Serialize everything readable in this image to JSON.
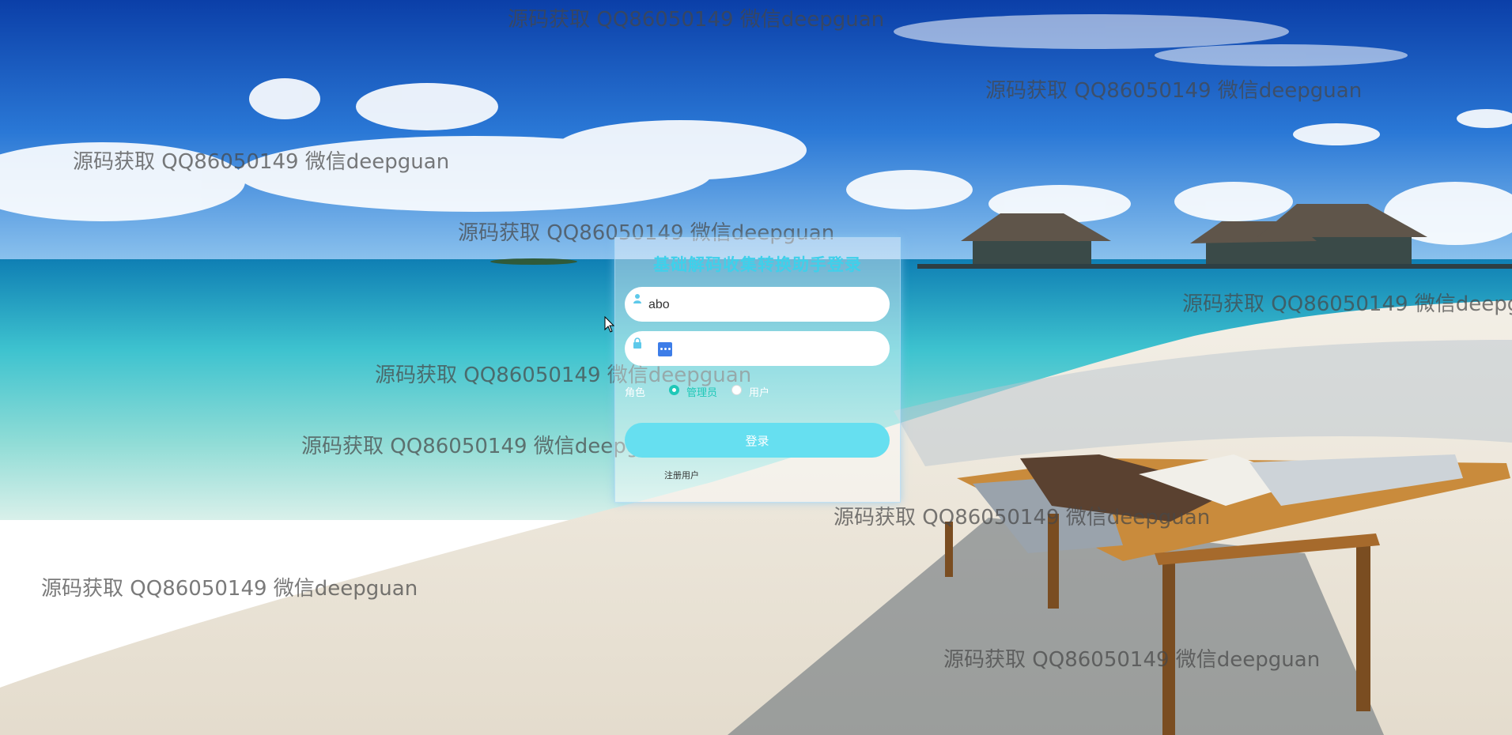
{
  "login": {
    "title": "基础解码收集转换助手登录",
    "username_value": "abo",
    "role_label": "角色",
    "roles": [
      {
        "label": "管理员",
        "selected": true
      },
      {
        "label": "用户",
        "selected": false
      }
    ],
    "login_button": "登录",
    "register_link": "注册用户"
  },
  "watermark": {
    "text": "源码获取 QQ86050149 微信deepguan"
  },
  "icons": {
    "username": "user-icon",
    "password": "lock-icon",
    "password_manager": "key-dots-icon",
    "cursor": "mouse-pointer-icon"
  },
  "colors": {
    "title": "#3fd0ea",
    "button": "#66dff0",
    "radio_selected": "#1fc8b8"
  }
}
